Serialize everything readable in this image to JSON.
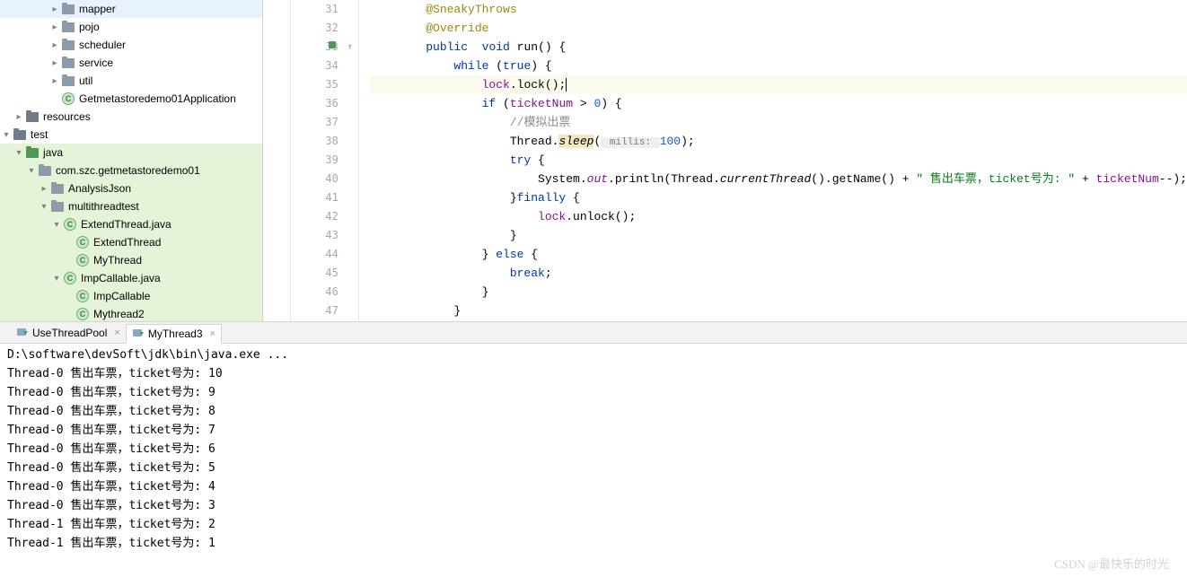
{
  "sidebar": {
    "items": [
      {
        "indent": 54,
        "arrow": "▸",
        "iconType": "folder-pkg",
        "label": "mapper"
      },
      {
        "indent": 54,
        "arrow": "▸",
        "iconType": "folder-pkg",
        "label": "pojo"
      },
      {
        "indent": 54,
        "arrow": "▸",
        "iconType": "folder-pkg",
        "label": "scheduler"
      },
      {
        "indent": 54,
        "arrow": "▸",
        "iconType": "folder-pkg",
        "label": "service"
      },
      {
        "indent": 54,
        "arrow": "▸",
        "iconType": "folder-pkg",
        "label": "util"
      },
      {
        "indent": 54,
        "arrow": "",
        "iconType": "class",
        "label": "Getmetastoredemo01Application"
      },
      {
        "indent": 14,
        "arrow": "▸",
        "iconType": "folder",
        "label": "resources"
      },
      {
        "indent": 0,
        "arrow": "▾",
        "iconType": "folder",
        "label": "test"
      },
      {
        "indent": 14,
        "arrow": "▾",
        "iconType": "folder-test",
        "label": "java",
        "highlighted": true
      },
      {
        "indent": 28,
        "arrow": "▾",
        "iconType": "folder-pkg",
        "label": "com.szc.getmetastoredemo01",
        "highlighted": true
      },
      {
        "indent": 42,
        "arrow": "▸",
        "iconType": "folder-pkg",
        "label": "AnalysisJson",
        "highlighted": true
      },
      {
        "indent": 42,
        "arrow": "▾",
        "iconType": "folder-pkg",
        "label": "multithreadtest",
        "highlighted": true
      },
      {
        "indent": 56,
        "arrow": "▾",
        "iconType": "class",
        "label": "ExtendThread.java",
        "highlighted": true
      },
      {
        "indent": 70,
        "arrow": "",
        "iconType": "class",
        "label": "ExtendThread",
        "highlighted": true
      },
      {
        "indent": 70,
        "arrow": "",
        "iconType": "class",
        "label": "MyThread",
        "highlighted": true
      },
      {
        "indent": 56,
        "arrow": "▾",
        "iconType": "class",
        "label": "ImpCallable.java",
        "highlighted": true
      },
      {
        "indent": 70,
        "arrow": "",
        "iconType": "class",
        "label": "ImpCallable",
        "highlighted": true
      },
      {
        "indent": 70,
        "arrow": "",
        "iconType": "class",
        "label": "Mythread2",
        "highlighted": true
      }
    ]
  },
  "editor": {
    "lines": [
      {
        "num": 31,
        "tokens": [
          {
            "t": "        ",
            "c": ""
          },
          {
            "t": "@SneakyThrows",
            "c": "anno"
          }
        ]
      },
      {
        "num": 32,
        "tokens": [
          {
            "t": "        ",
            "c": ""
          },
          {
            "t": "@Override",
            "c": "anno"
          }
        ]
      },
      {
        "num": 33,
        "mark": "impl",
        "tokens": [
          {
            "t": "        ",
            "c": ""
          },
          {
            "t": "public",
            "c": "kw"
          },
          {
            "t": "  ",
            "c": ""
          },
          {
            "t": "void",
            "c": "kw"
          },
          {
            "t": " run() {",
            "c": ""
          }
        ]
      },
      {
        "num": 34,
        "tokens": [
          {
            "t": "            ",
            "c": ""
          },
          {
            "t": "while",
            "c": "kw"
          },
          {
            "t": " (",
            "c": ""
          },
          {
            "t": "true",
            "c": "kw"
          },
          {
            "t": ") {",
            "c": ""
          }
        ]
      },
      {
        "num": 35,
        "highlighted": true,
        "tokens": [
          {
            "t": "                ",
            "c": ""
          },
          {
            "t": "lock",
            "c": "fld"
          },
          {
            "t": ".lock();",
            "c": ""
          },
          {
            "t": "",
            "c": "caret"
          }
        ]
      },
      {
        "num": 36,
        "tokens": [
          {
            "t": "                ",
            "c": ""
          },
          {
            "t": "if",
            "c": "kw"
          },
          {
            "t": " (",
            "c": ""
          },
          {
            "t": "ticketNum",
            "c": "fld"
          },
          {
            "t": " > ",
            "c": ""
          },
          {
            "t": "0",
            "c": "num"
          },
          {
            "t": ") {",
            "c": ""
          }
        ]
      },
      {
        "num": 37,
        "tokens": [
          {
            "t": "                    ",
            "c": ""
          },
          {
            "t": "//模拟出票",
            "c": "comment"
          }
        ]
      },
      {
        "num": 38,
        "tokens": [
          {
            "t": "                    Thread.",
            "c": ""
          },
          {
            "t": "sleep",
            "c": "mtd sleep-hl"
          },
          {
            "t": "(",
            "c": ""
          },
          {
            "t": " millis: ",
            "c": "hint"
          },
          {
            "t": "100",
            "c": "num"
          },
          {
            "t": ");",
            "c": ""
          }
        ]
      },
      {
        "num": 39,
        "tokens": [
          {
            "t": "                    ",
            "c": ""
          },
          {
            "t": "try",
            "c": "kw"
          },
          {
            "t": " {",
            "c": ""
          }
        ]
      },
      {
        "num": 40,
        "tokens": [
          {
            "t": "                        System.",
            "c": ""
          },
          {
            "t": "out",
            "c": "static-fld"
          },
          {
            "t": ".println(Thread.",
            "c": ""
          },
          {
            "t": "currentThread",
            "c": "mtd"
          },
          {
            "t": "().getName() + ",
            "c": ""
          },
          {
            "t": "\" 售出车票，ticket号为: \"",
            "c": "str"
          },
          {
            "t": " + ",
            "c": ""
          },
          {
            "t": "ticketNum",
            "c": "fld"
          },
          {
            "t": "--);",
            "c": ""
          }
        ]
      },
      {
        "num": 41,
        "tokens": [
          {
            "t": "                    }",
            "c": ""
          },
          {
            "t": "finally",
            "c": "kw"
          },
          {
            "t": " {",
            "c": ""
          }
        ]
      },
      {
        "num": 42,
        "tokens": [
          {
            "t": "                        ",
            "c": ""
          },
          {
            "t": "lock",
            "c": "fld"
          },
          {
            "t": ".unlock();",
            "c": ""
          }
        ]
      },
      {
        "num": 43,
        "tokens": [
          {
            "t": "                    }",
            "c": ""
          }
        ]
      },
      {
        "num": 44,
        "tokens": [
          {
            "t": "                } ",
            "c": ""
          },
          {
            "t": "else",
            "c": "kw"
          },
          {
            "t": " {",
            "c": ""
          }
        ]
      },
      {
        "num": 45,
        "tokens": [
          {
            "t": "                    ",
            "c": ""
          },
          {
            "t": "break",
            "c": "kw"
          },
          {
            "t": ";",
            "c": ""
          }
        ]
      },
      {
        "num": 46,
        "tokens": [
          {
            "t": "                }",
            "c": ""
          }
        ]
      },
      {
        "num": 47,
        "tokens": [
          {
            "t": "            }",
            "c": ""
          }
        ]
      }
    ]
  },
  "tabs": [
    {
      "label": "UseThreadPool",
      "active": false
    },
    {
      "label": "MyThread3",
      "active": true
    }
  ],
  "console": {
    "lines": [
      "D:\\software\\devSoft\\jdk\\bin\\java.exe ...",
      "Thread-0 售出车票，ticket号为: 10",
      "Thread-0 售出车票，ticket号为: 9",
      "Thread-0 售出车票，ticket号为: 8",
      "Thread-0 售出车票，ticket号为: 7",
      "Thread-0 售出车票，ticket号为: 6",
      "Thread-0 售出车票，ticket号为: 5",
      "Thread-0 售出车票，ticket号为: 4",
      "Thread-0 售出车票，ticket号为: 3",
      "Thread-1 售出车票，ticket号为: 2",
      "Thread-1 售出车票，ticket号为: 1"
    ]
  },
  "watermark": "CSDN @最快乐的时光"
}
